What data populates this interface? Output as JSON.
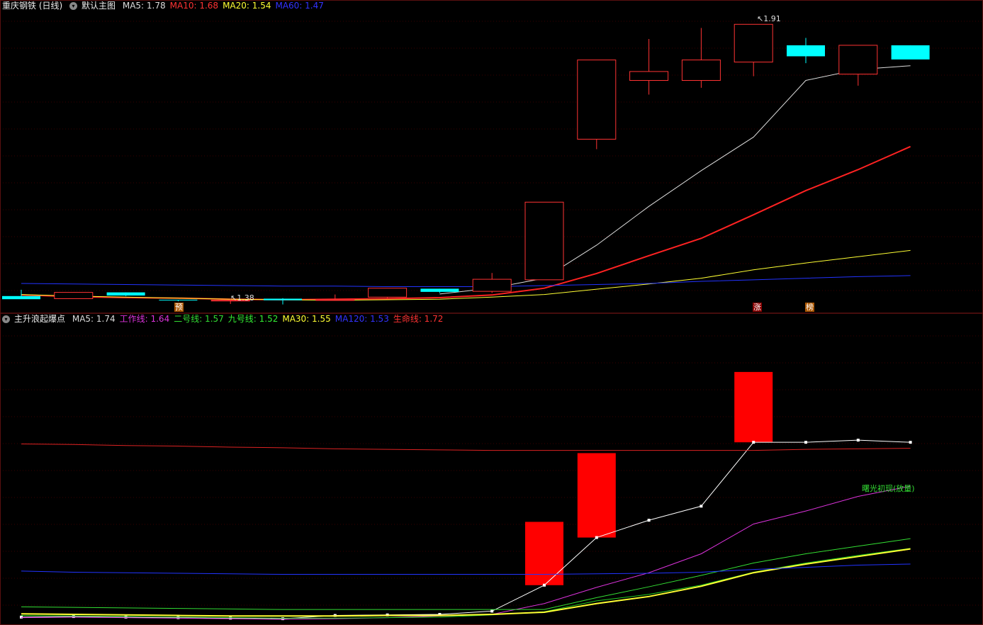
{
  "main_legend": {
    "title": "重庆钢铁 (日线)",
    "indicator": "默认主图",
    "items": [
      {
        "label": "MA5:",
        "value": "1.78",
        "color": "#dddddd"
      },
      {
        "label": "MA10:",
        "value": "1.68",
        "color": "#ff3333"
      },
      {
        "label": "MA20:",
        "value": "1.54",
        "color": "#ffff33"
      },
      {
        "label": "MA60:",
        "value": "1.47",
        "color": "#3333ff"
      }
    ]
  },
  "sub_legend": {
    "title": "主升浪起爆点",
    "items": [
      {
        "label": "MA5:",
        "value": "1.74",
        "color": "#dddddd"
      },
      {
        "label": "工作线:",
        "value": "1.64",
        "color": "#dd33dd"
      },
      {
        "label": "二号线:",
        "value": "1.57",
        "color": "#33dd33"
      },
      {
        "label": "九号线:",
        "value": "1.52",
        "color": "#33ee33"
      },
      {
        "label": "MA30:",
        "value": "1.55",
        "color": "#ffff33"
      },
      {
        "label": "MA120:",
        "value": "1.53",
        "color": "#3333ff"
      },
      {
        "label": "生命线:",
        "value": "1.72",
        "color": "#ff3333"
      }
    ]
  },
  "price_labels": {
    "high": "1.91",
    "low": "1.38"
  },
  "markers": {
    "yu": "预",
    "zhang": "涨",
    "bang": "榜"
  },
  "annotation": "曙光初现(放量)",
  "colors": {
    "up": "#ff3333",
    "down": "#00ffff",
    "background": "#000000"
  },
  "chart_data": [
    {
      "type": "candlestick",
      "title": "重庆钢铁 (日线)",
      "ylim": [
        1.36,
        1.93
      ],
      "candles": [
        {
          "o": 1.39,
          "h": 1.402,
          "l": 1.386,
          "c": 1.384
        },
        {
          "o": 1.385,
          "h": 1.397,
          "l": 1.385,
          "c": 1.397
        },
        {
          "o": 1.397,
          "h": 1.397,
          "l": 1.39,
          "c": 1.391
        },
        {
          "o": 1.383,
          "h": 1.383,
          "l": 1.38,
          "c": 1.382
        },
        {
          "o": 1.382,
          "h": 1.384,
          "l": 1.375,
          "c": 1.382
        },
        {
          "o": 1.385,
          "h": 1.386,
          "l": 1.374,
          "c": 1.382
        },
        {
          "o": 1.382,
          "h": 1.393,
          "l": 1.382,
          "c": 1.383
        },
        {
          "o": 1.388,
          "h": 1.405,
          "l": 1.386,
          "c": 1.405
        },
        {
          "o": 1.404,
          "h": 1.404,
          "l": 1.396,
          "c": 1.398
        },
        {
          "o": 1.399,
          "h": 1.434,
          "l": 1.396,
          "c": 1.422
        },
        {
          "o": 1.421,
          "h": 1.569,
          "l": 1.421,
          "c": 1.569
        },
        {
          "o": 1.689,
          "h": 1.84,
          "l": 1.67,
          "c": 1.84
        },
        {
          "o": 1.801,
          "h": 1.88,
          "l": 1.774,
          "c": 1.818
        },
        {
          "o": 1.801,
          "h": 1.901,
          "l": 1.787,
          "c": 1.84
        },
        {
          "o": 1.836,
          "h": 1.908,
          "l": 1.809,
          "c": 1.908
        },
        {
          "o": 1.868,
          "h": 1.882,
          "l": 1.834,
          "c": 1.847
        },
        {
          "o": 1.813,
          "h": 1.868,
          "l": 1.791,
          "c": 1.868
        },
        {
          "o": 1.868,
          "h": 1.868,
          "l": 1.855,
          "c": 1.841
        }
      ],
      "series": [
        {
          "name": "MA5",
          "values": [
            null,
            null,
            null,
            null,
            null,
            null,
            null,
            null,
            1.394,
            1.405,
            1.424,
            1.487,
            1.561,
            1.629,
            1.693,
            1.801,
            1.822,
            1.829
          ]
        },
        {
          "name": "MA10",
          "values": [
            1.392,
            1.389,
            1.387,
            1.386,
            1.384,
            1.383,
            1.384,
            1.385,
            1.387,
            1.392,
            1.405,
            1.433,
            1.467,
            1.5,
            1.545,
            1.591,
            1.631,
            1.675
          ]
        },
        {
          "name": "MA20",
          "values": [
            1.393,
            1.39,
            1.388,
            1.386,
            1.384,
            1.383,
            1.382,
            1.383,
            1.384,
            1.388,
            1.393,
            1.403,
            1.413,
            1.424,
            1.44,
            1.453,
            1.465,
            1.477
          ]
        },
        {
          "name": "MA60",
          "values": [
            1.414,
            1.413,
            1.412,
            1.411,
            1.41,
            1.409,
            1.409,
            1.408,
            1.408,
            1.408,
            1.41,
            1.412,
            1.414,
            1.418,
            1.421,
            1.424,
            1.427,
            1.429
          ]
        }
      ]
    },
    {
      "type": "line",
      "title": "主升浪起爆点",
      "ylim": [
        1.38,
        1.93
      ],
      "red_blocks": [
        {
          "index": 10,
          "from": 1.451,
          "to": 1.568
        },
        {
          "index": 11,
          "from": 1.539,
          "to": 1.695
        },
        {
          "index": 14,
          "from": 1.715,
          "to": 1.845
        }
      ],
      "series": [
        {
          "name": "MA5",
          "values": [
            1.392,
            1.393,
            1.392,
            1.391,
            1.39,
            1.389,
            1.395,
            1.396,
            1.397,
            1.403,
            1.451,
            1.539,
            1.571,
            1.597,
            1.715,
            1.715,
            1.719,
            1.715
          ]
        },
        {
          "name": "工作线",
          "values": [
            1.391,
            1.392,
            1.391,
            1.39,
            1.389,
            1.388,
            1.389,
            1.391,
            1.394,
            1.397,
            1.417,
            1.447,
            1.474,
            1.509,
            1.564,
            1.588,
            1.615,
            1.634
          ]
        },
        {
          "name": "二号线",
          "values": [
            1.411,
            1.41,
            1.409,
            1.408,
            1.407,
            1.406,
            1.406,
            1.406,
            1.406,
            1.406,
            1.406,
            1.428,
            1.448,
            1.469,
            1.492,
            1.509,
            1.523,
            1.537
          ]
        },
        {
          "name": "九号线",
          "values": [
            1.395,
            1.394,
            1.393,
            1.392,
            1.391,
            1.39,
            1.39,
            1.391,
            1.392,
            1.396,
            1.402,
            1.422,
            1.434,
            1.451,
            1.475,
            1.492,
            1.506,
            1.519
          ]
        },
        {
          "name": "MA30",
          "values": [
            1.398,
            1.397,
            1.396,
            1.395,
            1.394,
            1.394,
            1.394,
            1.395,
            1.395,
            1.397,
            1.401,
            1.417,
            1.43,
            1.449,
            1.474,
            1.49,
            1.504,
            1.518
          ]
        },
        {
          "name": "MA120",
          "values": [
            1.477,
            1.475,
            1.474,
            1.473,
            1.472,
            1.471,
            1.471,
            1.471,
            1.471,
            1.471,
            1.471,
            1.472,
            1.473,
            1.475,
            1.48,
            1.484,
            1.488,
            1.49
          ]
        },
        {
          "name": "生命线",
          "values": [
            1.712,
            1.711,
            1.709,
            1.708,
            1.706,
            1.705,
            1.703,
            1.702,
            1.701,
            1.7,
            1.7,
            1.7,
            1.7,
            1.7,
            1.7,
            1.702,
            1.703,
            1.704
          ]
        }
      ]
    }
  ]
}
